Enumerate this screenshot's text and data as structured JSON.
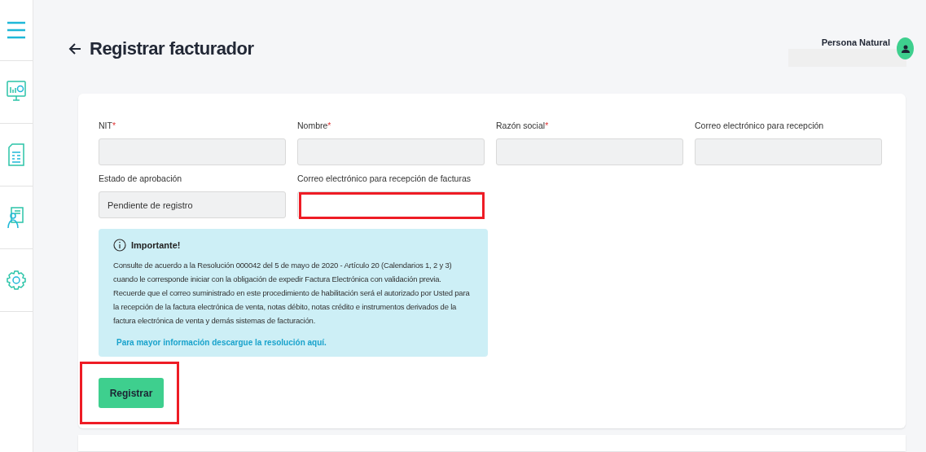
{
  "sidebar": {
    "items": [
      {
        "kind": "menu"
      },
      {
        "kind": "dashboard"
      },
      {
        "kind": "document"
      },
      {
        "kind": "person-board"
      },
      {
        "kind": "settings"
      }
    ]
  },
  "header": {
    "title": "Registrar facturador",
    "user": {
      "name": "Persona Natural",
      "redacted": true
    }
  },
  "form": {
    "fields": [
      {
        "label": "NIT",
        "required_mark": "*",
        "highlighted": false,
        "disabled": true
      },
      {
        "label": "Nombre",
        "required_mark": "*",
        "highlighted": false,
        "disabled": true
      },
      {
        "label": "Razón social",
        "required_mark": "*",
        "highlighted": false,
        "disabled": true
      },
      {
        "label": "Correo electrónico para recepción",
        "highlighted": false,
        "disabled": true
      },
      {
        "label": "Estado de aprobación",
        "value": "Pendiente de registro",
        "highlighted": false,
        "disabled": true
      },
      {
        "label": "Correo electrónico para recepción de facturas",
        "highlighted": true,
        "disabled": false
      }
    ],
    "notice": {
      "title": "Importante!",
      "body": "Consulte de acuerdo a la Resolución 000042 del 5 de mayo de 2020 - Artículo 20 (Calendarios 1, 2 y 3) cuando le corresponde iniciar con la obligación de expedir Factura Electrónica con validación previa. Recuerde que el correo suministrado en este procedimiento de habilitación será el autorizado por Usted para la recepción de la factura electrónica de venta, notas débito, notas crédito e instrumentos derivados de la factura electrónica de venta y demás sistemas de facturación.",
      "link": "Para mayor información descargue la resolución aquí."
    },
    "submit": {
      "label": "Registrar",
      "highlighted": true
    }
  }
}
